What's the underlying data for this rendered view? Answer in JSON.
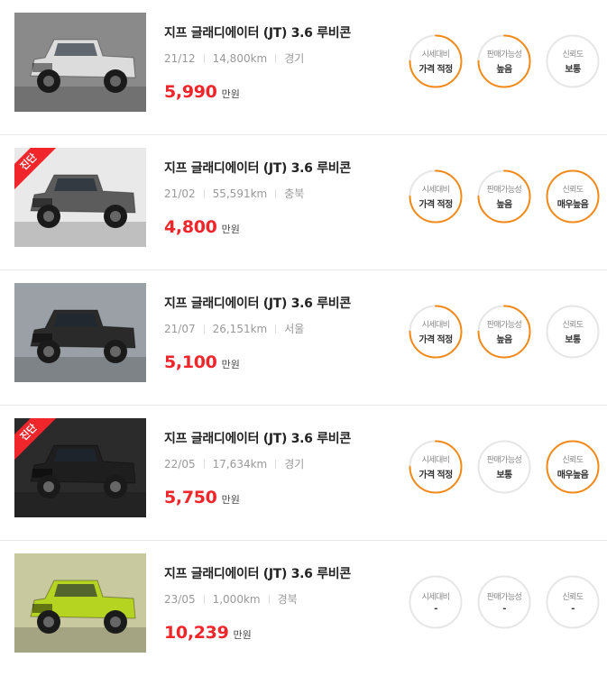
{
  "colors": {
    "accent": "#f28a1a",
    "price": "#f0262b",
    "ring_bg": "#e6e6e6",
    "diag_badge": "#f0262b"
  },
  "listings": [
    {
      "title": "지프 글래디에이터 (JT) 3.6 루비콘",
      "year": "21/12",
      "mileage": "14,800km",
      "region": "경기",
      "price": "5,990",
      "price_unit": "만원",
      "diag_badge": "",
      "car_color": "#dcdcdc",
      "bg_color": "#8a8a8a",
      "badges": [
        {
          "label": "시세대비",
          "value": "가격 적정",
          "level": 0.75
        },
        {
          "label": "판매가능성",
          "value": "높음",
          "level": 0.75
        },
        {
          "label": "신뢰도",
          "value": "보통",
          "level": 0.0
        }
      ]
    },
    {
      "title": "지프 글래디에이터 (JT) 3.6 루비콘",
      "year": "21/02",
      "mileage": "55,591km",
      "region": "충북",
      "price": "4,800",
      "price_unit": "만원",
      "diag_badge": "진단",
      "car_color": "#5c5c5c",
      "bg_color": "#e9e9e9",
      "badges": [
        {
          "label": "시세대비",
          "value": "가격 적정",
          "level": 0.75
        },
        {
          "label": "판매가능성",
          "value": "높음",
          "level": 0.75
        },
        {
          "label": "신뢰도",
          "value": "매우높음",
          "level": 1.0
        }
      ]
    },
    {
      "title": "지프 글래디에이터 (JT) 3.6 루비콘",
      "year": "21/07",
      "mileage": "26,151km",
      "region": "서울",
      "price": "5,100",
      "price_unit": "만원",
      "diag_badge": "",
      "car_color": "#2a2a2a",
      "bg_color": "#9aa0a6",
      "badges": [
        {
          "label": "시세대비",
          "value": "가격 적정",
          "level": 0.75
        },
        {
          "label": "판매가능성",
          "value": "높음",
          "level": 0.75
        },
        {
          "label": "신뢰도",
          "value": "보통",
          "level": 0.0
        }
      ]
    },
    {
      "title": "지프 글래디에이터 (JT) 3.6 루비콘",
      "year": "22/05",
      "mileage": "17,634km",
      "region": "경기",
      "price": "5,750",
      "price_unit": "만원",
      "diag_badge": "진단",
      "car_color": "#1e1e1e",
      "bg_color": "#2b2b2b",
      "badges": [
        {
          "label": "시세대비",
          "value": "가격 적정",
          "level": 0.75
        },
        {
          "label": "판매가능성",
          "value": "보통",
          "level": 0.0
        },
        {
          "label": "신뢰도",
          "value": "매우높음",
          "level": 1.0
        }
      ]
    },
    {
      "title": "지프 글래디에이터 (JT) 3.6 루비콘",
      "year": "23/05",
      "mileage": "1,000km",
      "region": "경북",
      "price": "10,239",
      "price_unit": "만원",
      "diag_badge": "",
      "car_color": "#b5d321",
      "bg_color": "#c9c9a0",
      "badges": [
        {
          "label": "시세대비",
          "value": "-",
          "level": 0.0
        },
        {
          "label": "판매가능성",
          "value": "-",
          "level": 0.0
        },
        {
          "label": "신뢰도",
          "value": "-",
          "level": 0.0
        }
      ]
    }
  ]
}
